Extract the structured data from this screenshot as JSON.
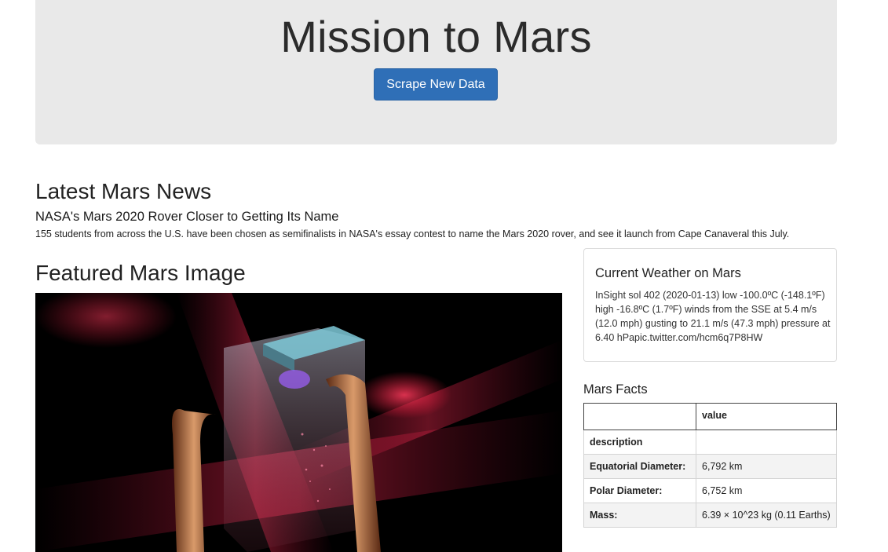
{
  "header": {
    "title": "Mission to Mars",
    "scrape_button_label": "Scrape New Data"
  },
  "news": {
    "heading": "Latest Mars News",
    "title": "NASA's Mars 2020 Rover Closer to Getting Its Name",
    "teaser": "155 students from across the U.S. have been chosen as semifinalists in NASA's essay contest to name the Mars 2020 rover, and see it launch from Cape Canaveral this July."
  },
  "featured_image": {
    "heading": "Featured Mars Image"
  },
  "weather": {
    "title": "Current Weather on Mars",
    "text": "InSight sol 402 (2020-01-13) low -100.0ºC (-148.1ºF) high -16.8ºC (1.7ºF) winds from the SSE at 5.4 m/s (12.0 mph) gusting to 21.1 m/s (47.3 mph) pressure at 6.40 hPapic.twitter.com/hcm6q7P8HW"
  },
  "facts": {
    "heading": "Mars Facts",
    "columns": [
      "",
      "value"
    ],
    "rows": [
      {
        "label": "description",
        "value": ""
      },
      {
        "label": "Equatorial Diameter:",
        "value": "6,792 km"
      },
      {
        "label": "Polar Diameter:",
        "value": "6,752 km"
      },
      {
        "label": "Mass:",
        "value": "6.39 × 10^23 kg (0.11 Earths)"
      }
    ]
  }
}
